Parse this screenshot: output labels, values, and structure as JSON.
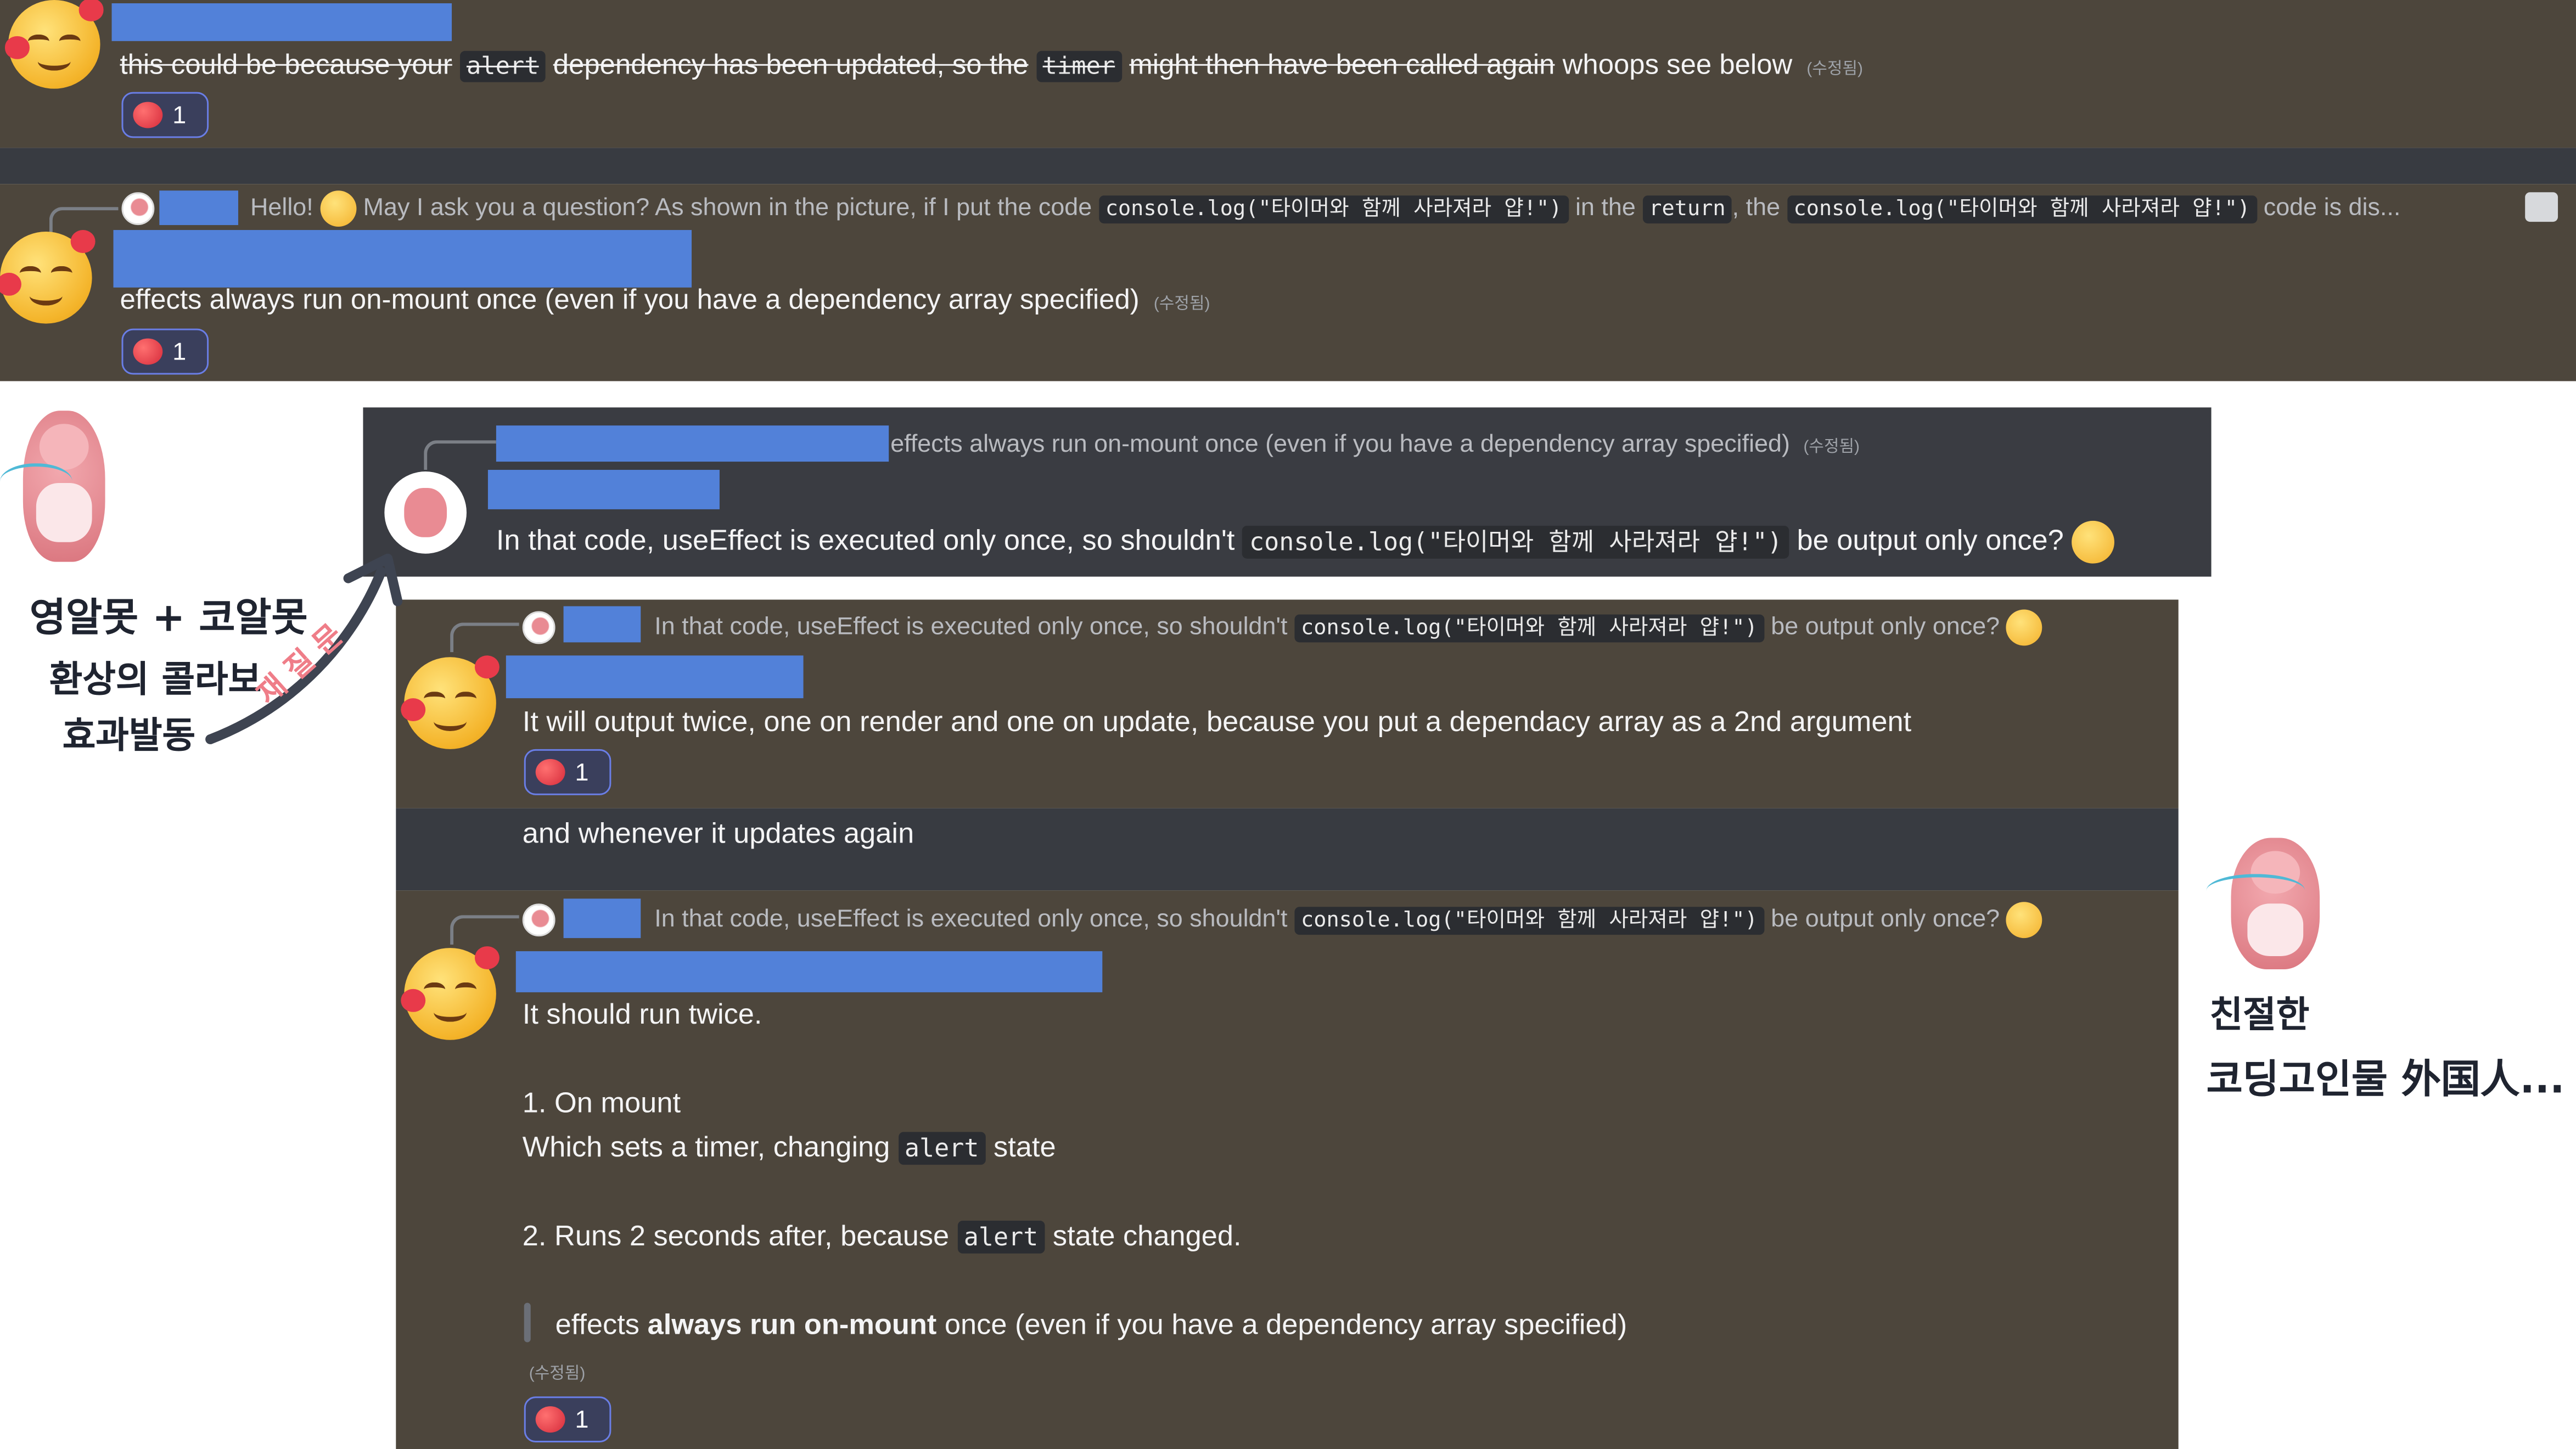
{
  "section1": {
    "message": {
      "struck_text_1": "this could be because your",
      "code_alert": "alert",
      "struck_text_2": "dependency has been updated, so the",
      "code_timer": "timer",
      "struck_text_3": "might then have been called again",
      "trailing_text": "whoops see below",
      "edited_tag": "(수정됨)"
    },
    "reaction_count": "1"
  },
  "section2": {
    "reply_preview": {
      "hello_text": "Hello!",
      "text_1": "May I ask you a question? As shown in the picture, if I put the code",
      "code_1": "console.log(\"타이머와 함께 사라져라 얍!\")",
      "text_2": "in the",
      "code_return": "return",
      "text_3": ", the",
      "code_2": "console.log(\"타이머와 함께 사라져라 얍!\")",
      "text_4": "code is dis..."
    },
    "message": "effects always run on-mount once (even if you have a dependency array specified)",
    "edited_tag": "(수정됨)",
    "reaction_count": "1"
  },
  "section3": {
    "reply_preview": "effects always run on-mount once (even if you have a dependency array specified)",
    "reply_edited": "(수정됨)",
    "message_prefix": "In that code, useEffect is executed only once, so shouldn't",
    "message_code": "console.log(\"타이머와 함께 사라져라 얍!\")",
    "message_suffix": "be output only once?"
  },
  "section4": {
    "reply_prefix": "In that code, useEffect is executed only once, so shouldn't",
    "reply_code": "console.log(\"타이머와 함께 사라져라 얍!\")",
    "reply_suffix": "be output only once?",
    "message": "It will output twice, one on render and one on update, because you put a dependacy array as a 2nd argument",
    "reaction_count": "1",
    "followup": "and whenever it updates again"
  },
  "section5": {
    "reply_prefix": "In that code, useEffect is executed only once, so shouldn't",
    "reply_code": "console.log(\"타이머와 함께 사라져라 얍!\")",
    "reply_suffix": "be output only once?",
    "line1": "It should run twice.",
    "line2": "1. On mount",
    "line3_prefix": "Which sets a timer, changing",
    "line3_code": "alert",
    "line3_suffix": "state",
    "line4_prefix": "2. Runs 2 seconds after, because",
    "line4_code": "alert",
    "line4_suffix": "state changed.",
    "quote_1": "effects",
    "quote_bold": "always run on-mount",
    "quote_2": "once (even if you have a dependency array specified)",
    "edited_tag": "(수정됨)",
    "reaction_count": "1"
  },
  "annotations": {
    "left_line1": "영알못 + 코알못",
    "left_line2": "환상의 콜라보",
    "left_line3": "효과발동",
    "arrow_label": "재 질 문",
    "right_line1": "친절한",
    "right_line2": "코딩고인물 外国人..."
  },
  "colors": {
    "panel_brown": "#4d463c",
    "panel_dark": "#383b41",
    "redaction": "#5281d9",
    "annotation_pink": "#ef7d88"
  }
}
